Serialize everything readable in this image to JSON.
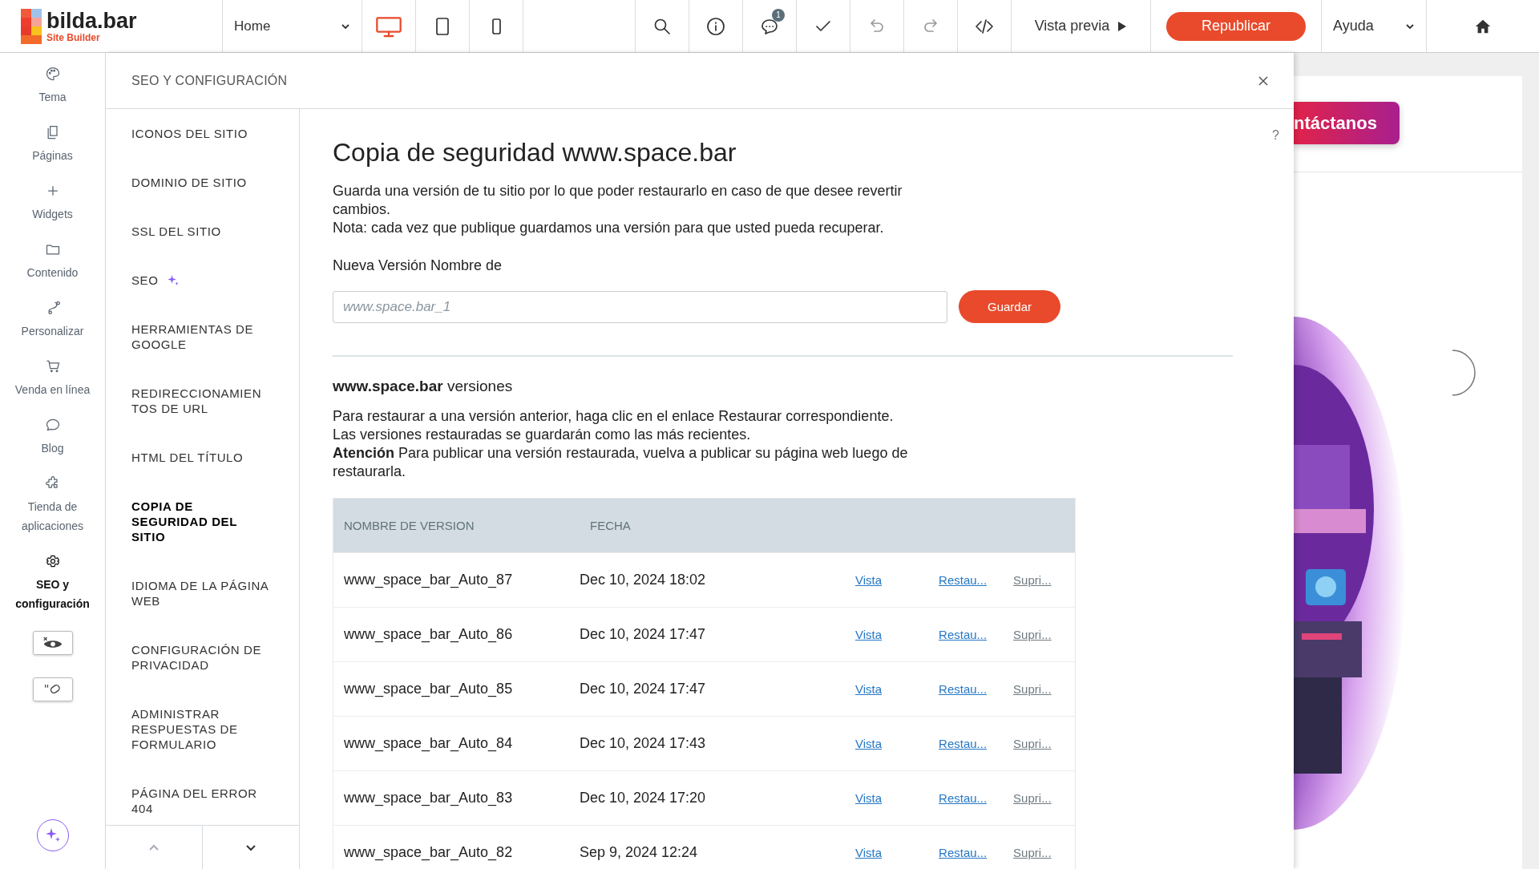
{
  "topbar": {
    "logo": {
      "name": "bilda.bar",
      "tagline": "Site Builder"
    },
    "page_select": "Home",
    "devices": [
      {
        "selected": true
      },
      {
        "selected": false
      },
      {
        "selected": false
      }
    ],
    "comments_badge": "1",
    "preview": "Vista previa",
    "publish": "Republicar",
    "help": "Ayuda"
  },
  "sidebar": {
    "items": [
      {
        "label": "Tema",
        "selected": false
      },
      {
        "label": "Páginas",
        "selected": false
      },
      {
        "label": "Widgets",
        "selected": false
      },
      {
        "label": "Contenido",
        "selected": false
      },
      {
        "label": "Personalizar",
        "selected": false
      },
      {
        "label": "Venda en línea",
        "selected": false
      },
      {
        "label": "Blog",
        "selected": false
      },
      {
        "label": "Tienda de aplicaciones",
        "selected": false
      },
      {
        "label": "SEO y configuración",
        "selected": true
      }
    ]
  },
  "panel": {
    "title": "SEO Y CONFIGURACIÓN",
    "menu": [
      {
        "label": "ICONOS DEL SITIO",
        "selected": false,
        "sparkle": false
      },
      {
        "label": "DOMINIO DE SITIO",
        "selected": false,
        "sparkle": false
      },
      {
        "label": "SSL DEL SITIO",
        "selected": false,
        "sparkle": false
      },
      {
        "label": "SEO",
        "selected": false,
        "sparkle": true
      },
      {
        "label": "HERRAMIENTAS DE GOOGLE",
        "selected": false,
        "sparkle": false
      },
      {
        "label": "REDIRECCIONAMIEN TOS DE URL",
        "selected": false,
        "sparkle": false
      },
      {
        "label": "HTML DEL TÍTULO",
        "selected": false,
        "sparkle": false
      },
      {
        "label": "COPIA DE SEGURIDAD DEL SITIO",
        "selected": true,
        "sparkle": false
      },
      {
        "label": "IDIOMA DE LA PÁGINA WEB",
        "selected": false,
        "sparkle": false
      },
      {
        "label": "CONFIGURACIÓN DE PRIVACIDAD",
        "selected": false,
        "sparkle": false
      },
      {
        "label": "ADMINISTRAR RESPUESTAS DE FORMULARIO",
        "selected": false,
        "sparkle": false
      },
      {
        "label": "PÁGINA DEL ERROR 404",
        "selected": false,
        "sparkle": false
      }
    ],
    "help": "?",
    "content": {
      "title": "Copia de seguridad www.space.bar",
      "intro": [
        "Guarda una versión de tu sitio por lo que poder restaurarlo en caso de que desee revertir cambios.",
        "Nota: cada vez que publique guardamos una versión para que usted pueda recuperar."
      ],
      "field_label": "Nueva Versión Nombre de",
      "placeholder": "www.space.bar_1",
      "save": "Guardar",
      "versions_heading": "**www.space.bar** versiones",
      "versions_text": [
        "Para restaurar a una versión anterior, haga clic en el enlace Restaurar correspondiente.",
        "Las versiones restauradas se guardarán como las más recientes.",
        "**Atención** Para publicar una versión restaurada, vuelva a publicar su página web luego de restaurarla."
      ],
      "table": {
        "columns": [
          "NOMBRE DE VERSION",
          "FECHA"
        ],
        "rows": [
          {
            "name": "www_space_bar_Auto_87",
            "date": "Dec 10, 2024 18:02",
            "view": "Vista",
            "restore": "Restau...",
            "delete": "Supri..."
          },
          {
            "name": "www_space_bar_Auto_86",
            "date": "Dec 10, 2024 17:47",
            "view": "Vista",
            "restore": "Restau...",
            "delete": "Supri..."
          },
          {
            "name": "www_space_bar_Auto_85",
            "date": "Dec 10, 2024 17:47",
            "view": "Vista",
            "restore": "Restau...",
            "delete": "Supri..."
          },
          {
            "name": "www_space_bar_Auto_84",
            "date": "Dec 10, 2024 17:43",
            "view": "Vista",
            "restore": "Restau...",
            "delete": "Supri..."
          },
          {
            "name": "www_space_bar_Auto_83",
            "date": "Dec 10, 2024 17:20",
            "view": "Vista",
            "restore": "Restau...",
            "delete": "Supri..."
          },
          {
            "name": "www_space_bar_Auto_82",
            "date": "Sep 9, 2024 12:24",
            "view": "Vista",
            "restore": "Restau...",
            "delete": "Supri..."
          }
        ]
      }
    }
  },
  "preview": {
    "contact_button": "ntáctanos"
  }
}
